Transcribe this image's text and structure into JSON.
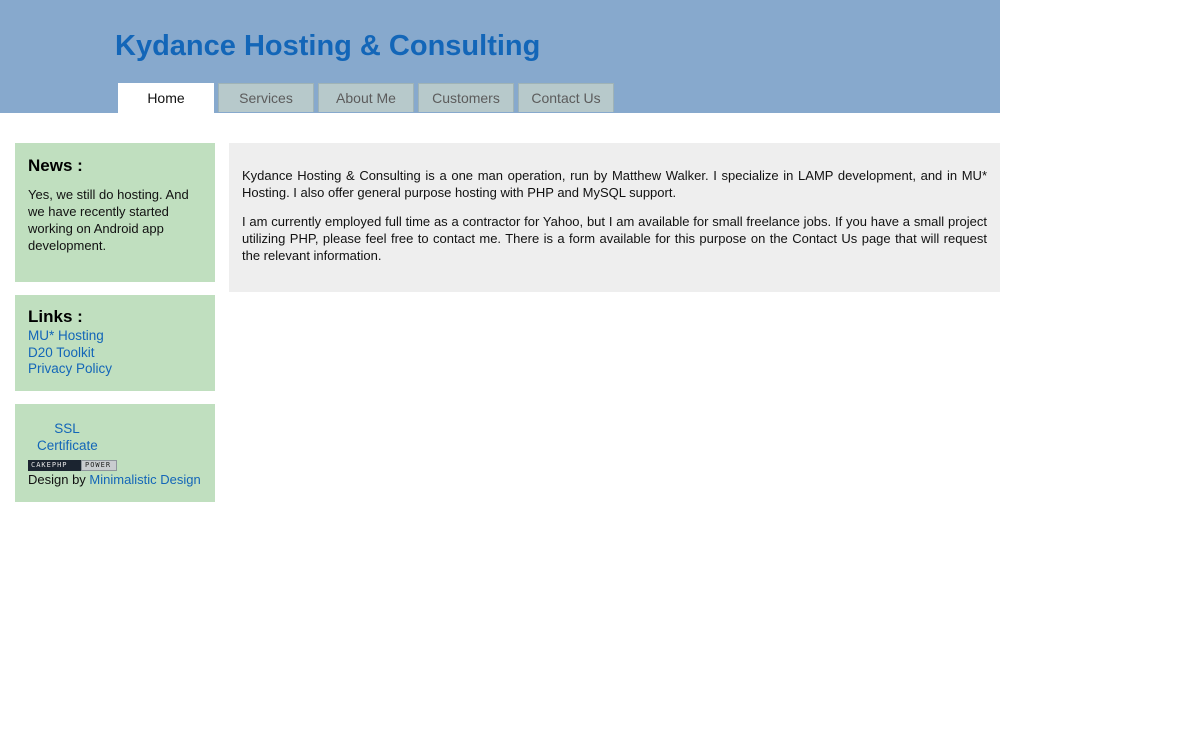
{
  "header": {
    "title": "Kydance Hosting & Consulting",
    "background_color": "#87a9cd",
    "title_color": "#1366b8"
  },
  "nav": {
    "tabs": [
      {
        "label": "Home",
        "active": true
      },
      {
        "label": "Services",
        "active": false
      },
      {
        "label": "About Me",
        "active": false
      },
      {
        "label": "Customers",
        "active": false
      },
      {
        "label": "Contact Us",
        "active": false
      }
    ]
  },
  "sidebar": {
    "news": {
      "heading": "News :",
      "text": "Yes, we still do hosting. And we have recently started working on Android app development."
    },
    "links": {
      "heading": "Links :",
      "items": [
        "MU* Hosting",
        "D20 Toolkit",
        "Privacy Policy"
      ]
    },
    "badges": {
      "ssl_label": "SSL Certificate",
      "cakephp_left": "CAKEPHP",
      "cakephp_right": "POWER",
      "design_prefix": "Design by ",
      "design_link": "Minimalistic Design"
    },
    "box_color": "#c0dfbf"
  },
  "main": {
    "paragraphs": [
      "Kydance Hosting & Consulting is a one man operation, run by Matthew Walker. I specialize in LAMP development, and in MU* Hosting. I also offer general purpose hosting with PHP and MySQL support.",
      "I am currently employed full time as a contractor for Yahoo, but I am available for small freelance jobs. If you have a small project utilizing PHP, please feel free to contact me. There is a form available for this purpose on the Contact Us page that will request the relevant information."
    ],
    "background_color": "#eeeeee"
  }
}
